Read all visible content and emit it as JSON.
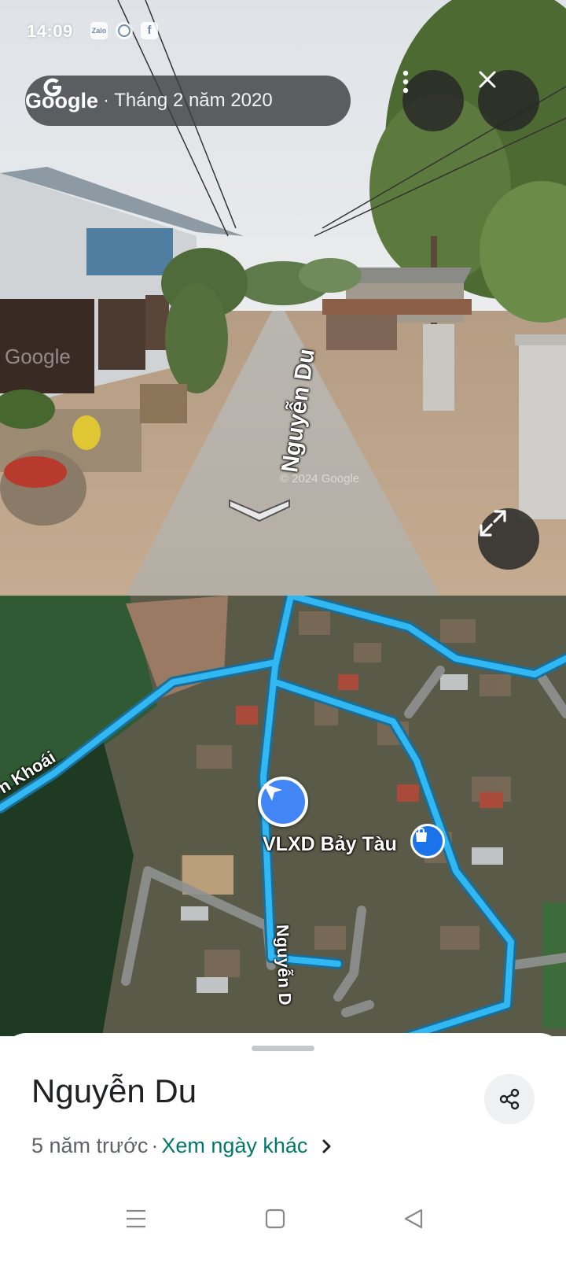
{
  "status_bar": {
    "time": "14:09",
    "notification_icons": [
      "zalo-icon",
      "messenger-icon",
      "facebook-icon"
    ],
    "zalo_text": "Zalo"
  },
  "street_view": {
    "brand": "Google",
    "date": "· Tháng 2 năm 2020",
    "road_label": "Nguyễn Du",
    "watermark_1": "Google",
    "watermark_2": "© 2024 Google",
    "buttons": [
      "more-options",
      "close",
      "expand"
    ]
  },
  "map": {
    "road_label_left": "n Khoái",
    "road_label_center": "Nguyễn D",
    "poi_label": "VLXD Bảy Tàu",
    "route_color": "#31b8f3"
  },
  "sheet": {
    "title": "Nguyễn Du",
    "age": "5 năm trước",
    "link": "Xem ngày khác"
  },
  "system_nav": [
    "menu",
    "home",
    "back"
  ]
}
